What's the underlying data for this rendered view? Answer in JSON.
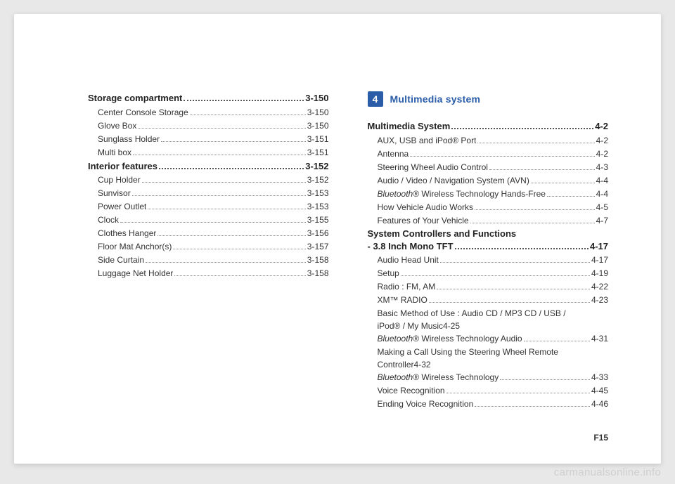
{
  "left_column": {
    "groups": [
      {
        "main": {
          "label": "Storage compartment",
          "page": "3-150"
        },
        "subs": [
          {
            "label": "Center Console Storage",
            "page": "3-150"
          },
          {
            "label": "Glove Box",
            "page": "3-150"
          },
          {
            "label": "Sunglass Holder",
            "page": "3-151"
          },
          {
            "label": "Multi box",
            "page": "3-151"
          }
        ]
      },
      {
        "main": {
          "label": "Interior features",
          "page": "3-152"
        },
        "subs": [
          {
            "label": "Cup Holder",
            "page": "3-152"
          },
          {
            "label": "Sunvisor",
            "page": "3-153"
          },
          {
            "label": "Power Outlet",
            "page": "3-153"
          },
          {
            "label": "Clock",
            "page": "3-155"
          },
          {
            "label": "Clothes Hanger",
            "page": "3-156"
          },
          {
            "label": "Floor Mat Anchor(s)",
            "page": "3-157"
          },
          {
            "label": "Side Curtain",
            "page": "3-158"
          },
          {
            "label": "Luggage Net Holder",
            "page": "3-158"
          }
        ]
      }
    ]
  },
  "right_column": {
    "section_number": "4",
    "section_title": "Multimedia system",
    "groups": [
      {
        "main": {
          "label": "Multimedia System",
          "page": "4-2"
        },
        "subs": [
          {
            "label": "AUX, USB and iPod® Port",
            "page": "4-2"
          },
          {
            "label": "Antenna",
            "page": "4-2"
          },
          {
            "label": "Steering Wheel Audio Control",
            "page": "4-3"
          },
          {
            "label": "Audio / Video / Navigation System (AVN)",
            "page": "4-4"
          },
          {
            "label_html": "<span class='italic'>Bluetooth</span>® Wireless Technology Hands-Free",
            "page": "4-4"
          },
          {
            "label": "How Vehicle Audio Works",
            "page": "4-5"
          },
          {
            "label": "Features of Your Vehicle",
            "page": "4-7"
          }
        ]
      },
      {
        "main_multiline": {
          "line1": "System Controllers and Functions",
          "line2_prefix": "- 3.8 Inch Mono TFT",
          "page": "4-17"
        },
        "subs": [
          {
            "label": "Audio Head Unit",
            "page": "4-17"
          },
          {
            "label": "Setup",
            "page": "4-19"
          },
          {
            "label": "Radio : FM, AM",
            "page": "4-22"
          },
          {
            "label": "XM™ RADIO",
            "page": "4-23"
          },
          {
            "label_wrap": "Basic Method of Use : Audio CD / MP3 CD / USB / iPod® / My Music",
            "page": "4-25"
          },
          {
            "label_html": "<span class='italic'>Bluetooth</span>® Wireless Technology Audio",
            "page": "4-31"
          },
          {
            "label_wrap": "Making a Call Using the Steering Wheel Remote Controller",
            "page": "4-32"
          },
          {
            "label_html": "<span class='italic'>Bluetooth</span>® Wireless Technology",
            "page": "4-33"
          },
          {
            "label": "Voice Recognition",
            "page": "4-45"
          },
          {
            "label": "Ending Voice Recognition",
            "page": "4-46"
          }
        ]
      }
    ]
  },
  "footer_page": "F15",
  "watermark": "carmanualsonline.info"
}
